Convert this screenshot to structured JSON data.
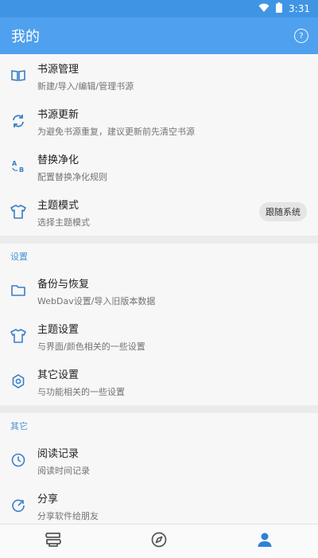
{
  "status_bar": {
    "time": "3:31"
  },
  "app_bar": {
    "title": "我的"
  },
  "menu_top": [
    {
      "title": "书源管理",
      "desc": "新建/导入/编辑/管理书源",
      "icon": "book-open-icon"
    },
    {
      "title": "书源更新",
      "desc": "为避免书源重复，建议更新前先清空书源",
      "icon": "refresh-icon"
    },
    {
      "title": "替换净化",
      "desc": "配置替换净化规则",
      "icon": "replace-ab-icon"
    },
    {
      "title": "主题模式",
      "desc": "选择主题模式",
      "icon": "tshirt-icon",
      "badge": "跟随系统"
    }
  ],
  "section_settings": {
    "header": "设置",
    "items": [
      {
        "title": "备份与恢复",
        "desc": "WebDav设置/导入旧版本数据",
        "icon": "folder-icon"
      },
      {
        "title": "主题设置",
        "desc": "与界面/颜色相关的一些设置",
        "icon": "tshirt-icon"
      },
      {
        "title": "其它设置",
        "desc": "与功能相关的一些设置",
        "icon": "settings-icon"
      }
    ]
  },
  "section_other": {
    "header": "其它",
    "items": [
      {
        "title": "阅读记录",
        "desc": "阅读时间记录",
        "icon": "clock-icon"
      },
      {
        "title": "分享",
        "desc": "分享软件给朋友",
        "icon": "share-icon"
      }
    ]
  },
  "bottom_nav": {
    "items": [
      {
        "name": "bookshelf",
        "icon": "bookshelf-icon",
        "active": false
      },
      {
        "name": "discover",
        "icon": "compass-icon",
        "active": false
      },
      {
        "name": "mine",
        "icon": "person-icon",
        "active": true
      }
    ]
  },
  "colors": {
    "accent": "#4fa0ee",
    "icon": "#3b7fc7",
    "section_header": "#4a90d9",
    "nav_inactive": "#555555"
  }
}
